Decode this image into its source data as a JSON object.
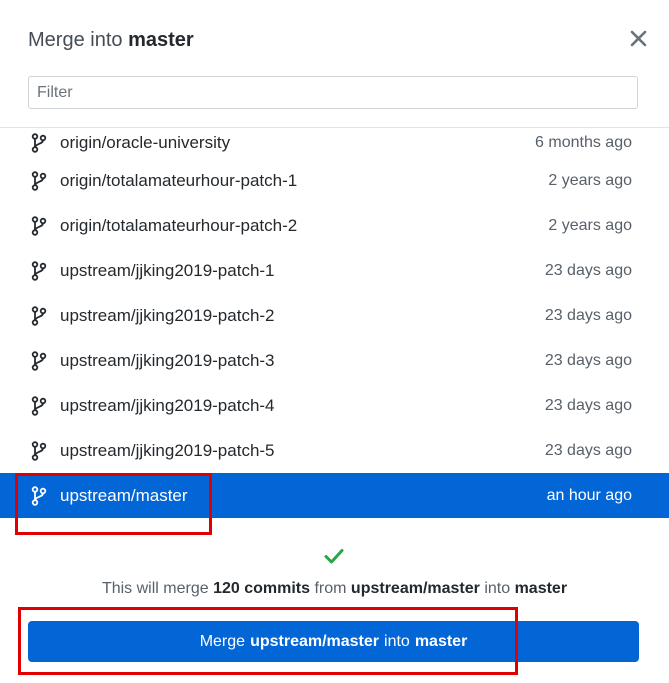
{
  "dialog": {
    "title_prefix": "Merge into",
    "title_branch": "master",
    "close_icon": "close-icon"
  },
  "filter": {
    "placeholder": "Filter",
    "value": ""
  },
  "branches": [
    {
      "name": "origin/oracle-university",
      "time": "6 months ago"
    },
    {
      "name": "origin/totalamateurhour-patch-1",
      "time": "2 years ago"
    },
    {
      "name": "origin/totalamateurhour-patch-2",
      "time": "2 years ago"
    },
    {
      "name": "upstream/jjking2019-patch-1",
      "time": "23 days ago"
    },
    {
      "name": "upstream/jjking2019-patch-2",
      "time": "23 days ago"
    },
    {
      "name": "upstream/jjking2019-patch-3",
      "time": "23 days ago"
    },
    {
      "name": "upstream/jjking2019-patch-4",
      "time": "23 days ago"
    },
    {
      "name": "upstream/jjking2019-patch-5",
      "time": "23 days ago"
    },
    {
      "name": "upstream/master",
      "time": "an hour ago",
      "selected": true
    }
  ],
  "summary": {
    "prefix": "This will merge",
    "count": "120 commits",
    "from_word": "from",
    "source": "upstream/master",
    "into_word": "into",
    "target": "master"
  },
  "merge_button": {
    "verb": "Merge",
    "source": "upstream/master",
    "into_word": "into",
    "target": "master"
  },
  "colors": {
    "accent": "#0366d6",
    "success": "#28a745",
    "annotation": "#e00000"
  },
  "icons": {
    "branch": "git-branch-icon",
    "check": "check-icon"
  }
}
